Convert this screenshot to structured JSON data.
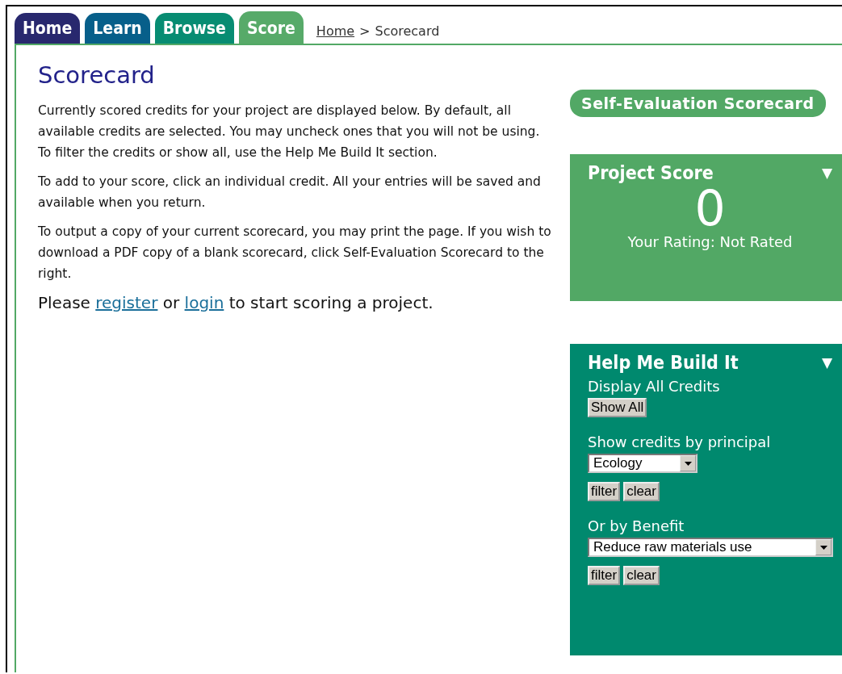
{
  "tabs": [
    {
      "label": "Home",
      "color": "#22226a",
      "selected": false
    },
    {
      "label": "Learn",
      "color": "#005a87",
      "selected": false
    },
    {
      "label": "Browse",
      "color": "#00896e",
      "selected": false
    },
    {
      "label": "Score",
      "color": "#52a865",
      "selected": true
    }
  ],
  "breadcrumb": {
    "link": "Home",
    "separator": ">",
    "current": "Scorecard"
  },
  "page_title": "Scorecard",
  "paragraphs": [
    "Currently scored credits for your project are displayed below. By default, all available credits are selected. You may uncheck ones that you will not be using. To filter the credits or show all, use the Help Me Build It section.",
    "To add to your score, click an individual credit. All your entries will be saved and available when you return.",
    "To output a copy of your current scorecard, you may print the page. If you wish to download a PDF copy of a blank scorecard, click Self-Evaluation Scorecard to the right."
  ],
  "prompt": {
    "before": "Please",
    "register": "register",
    "middle": "or",
    "login": "login",
    "after": "to start scoring a project."
  },
  "scorecard_button": "Self-Evaluation Scorecard",
  "project_score": {
    "title": "Project Score",
    "collapse": "▼",
    "score": "0",
    "rating": "Your Rating: Not Rated"
  },
  "help": {
    "title": "Help Me Build It",
    "collapse": "▼",
    "display_label": "Display All Credits",
    "show_all": "Show All",
    "principal_label": "Show credits by principal",
    "principal_value": "Ecology",
    "principal_filter": "filter",
    "principal_clear": "clear",
    "benefit_label": "Or by Benefit",
    "benefit_value": "Reduce raw materials use",
    "benefit_filter": "filter",
    "benefit_clear": "clear"
  }
}
